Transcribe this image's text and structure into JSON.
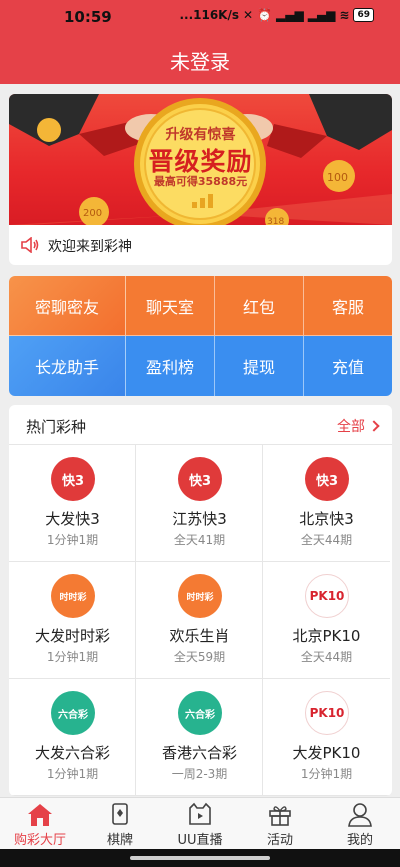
{
  "status": {
    "time": "10:59",
    "net": "...116K/s",
    "battery": "69"
  },
  "header": {
    "title": "未登录"
  },
  "banner": {
    "line1": "升级有惊喜",
    "line2": "晋级奖励",
    "line3": "最高可得35888元",
    "chip1": "100",
    "chip2": "200",
    "chip3": "318"
  },
  "notice": {
    "text": "欢迎来到彩神"
  },
  "menu": {
    "row1": [
      "密聊密友",
      "聊天室",
      "红包",
      "客服"
    ],
    "row2": [
      "长龙助手",
      "盈利榜",
      "提现",
      "充值"
    ]
  },
  "hot": {
    "title": "热门彩种",
    "all": "全部",
    "games": [
      {
        "name": "大发快3",
        "sub": "1分钟1期",
        "icon": "k3-icon",
        "icon_text": "快3"
      },
      {
        "name": "江苏快3",
        "sub": "全天41期",
        "icon": "k3-icon",
        "icon_text": "快3"
      },
      {
        "name": "北京快3",
        "sub": "全天44期",
        "icon": "k3-icon",
        "icon_text": "快3"
      },
      {
        "name": "大发时时彩",
        "sub": "1分钟1期",
        "icon": "ssc-icon",
        "icon_text": "时时彩"
      },
      {
        "name": "欢乐生肖",
        "sub": "全天59期",
        "icon": "ssc-icon",
        "icon_text": "时时彩"
      },
      {
        "name": "北京PK10",
        "sub": "全天44期",
        "icon": "pk10-icon",
        "icon_text": "PK10"
      },
      {
        "name": "大发六合彩",
        "sub": "1分钟1期",
        "icon": "lhc-icon",
        "icon_text": "六合彩"
      },
      {
        "name": "香港六合彩",
        "sub": "一周2-3期",
        "icon": "lhc-icon",
        "icon_text": "六合彩"
      },
      {
        "name": "大发PK10",
        "sub": "1分钟1期",
        "icon": "pk10-icon",
        "icon_text": "PK10"
      }
    ]
  },
  "nav": {
    "items": [
      "购彩大厅",
      "棋牌",
      "UU直播",
      "活动",
      "我的"
    ],
    "active": "购彩大厅"
  },
  "colors": {
    "brand": "#e54148",
    "orange": "#f47a33",
    "blue": "#3a8ef0",
    "green": "#27b38f"
  }
}
